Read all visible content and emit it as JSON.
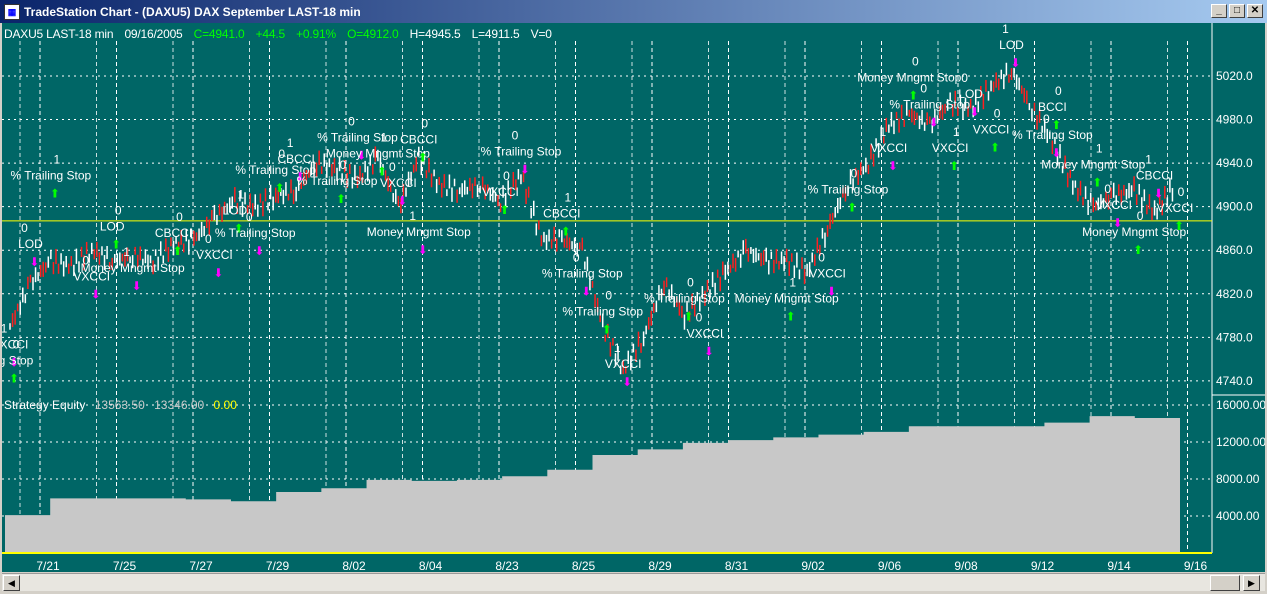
{
  "window": {
    "title": "TradeStation Chart - (DAXU5) DAX September LAST-18 min",
    "minimize": "_",
    "maximize": "□",
    "close": "✕"
  },
  "header": {
    "symbol": "DAXU5 LAST-18 min",
    "date": "09/16/2005",
    "close": "C=4941.0",
    "change": "+44.5",
    "pct": "+0.91%",
    "open": "O=4912.0",
    "high": "H=4945.5",
    "low": "L=4911.5",
    "volume": "V=0"
  },
  "equity_header": {
    "label": "Strategy Equity",
    "v1": "13563.50",
    "v2": "13346.00",
    "v3": "0.00"
  },
  "colors": {
    "bg": "#006666",
    "up": "#ffffff",
    "down": "#ff2020",
    "long": "#00ff00",
    "short": "#ff00ff",
    "ref": "#ffff00",
    "equity": "#c8c8c8"
  },
  "chart_data": [
    {
      "type": "line",
      "name": "price",
      "title": "DAXU5 LAST-18 min",
      "yticks": [
        "5020.0",
        "4980.0",
        "4940.0",
        "4900.0",
        "4860.0",
        "4820.0",
        "4780.0",
        "4740.0"
      ],
      "ylim": [
        4725,
        5060
      ],
      "reference_line": 4887,
      "closes": [
        4790,
        4830,
        4850,
        4845,
        4860,
        4850,
        4855,
        4850,
        4865,
        4870,
        4890,
        4905,
        4900,
        4910,
        4915,
        4940,
        4935,
        4925,
        4945,
        4900,
        4945,
        4920,
        4915,
        4920,
        4905,
        4930,
        4870,
        4870,
        4860,
        4790,
        4750,
        4780,
        4830,
        4800,
        4820,
        4840,
        4860,
        4850,
        4850,
        4840,
        4880,
        4920,
        4940,
        4975,
        4985,
        4975,
        4995,
        4990,
        5010,
        5025,
        4990,
        4960,
        4920,
        4900,
        4910,
        4915,
        4895,
        4920
      ],
      "signals": [
        {
          "i": 0,
          "p": 4770,
          "label": "VXCCI"
        },
        {
          "i": 0,
          "p": 4755,
          "label": "ling Stop"
        },
        {
          "i": 1,
          "p": 4862,
          "label": "LOD"
        },
        {
          "i": 2,
          "p": 4925,
          "label": "% Trailing Stop"
        },
        {
          "i": 4,
          "p": 4832,
          "label": "VXCCI"
        },
        {
          "i": 5,
          "p": 4878,
          "label": "LOD"
        },
        {
          "i": 6,
          "p": 4840,
          "label": "Money Mngmt Stop"
        },
        {
          "i": 8,
          "p": 4872,
          "label": "CBCCI"
        },
        {
          "i": 10,
          "p": 4852,
          "label": "VXCCI"
        },
        {
          "i": 11,
          "p": 4893,
          "label": "LOD"
        },
        {
          "i": 12,
          "p": 4872,
          "label": "% Trailing Stop"
        },
        {
          "i": 13,
          "p": 4930,
          "label": "% Trailing Stop"
        },
        {
          "i": 14,
          "p": 4940,
          "label": "CBCCI"
        },
        {
          "i": 16,
          "p": 4920,
          "label": "% Trailing Stop"
        },
        {
          "i": 17,
          "p": 4960,
          "label": "% Trailing Stop"
        },
        {
          "i": 18,
          "p": 4945,
          "label": "Money Mngmt Stop"
        },
        {
          "i": 19,
          "p": 4918,
          "label": "VXCCI"
        },
        {
          "i": 20,
          "p": 4958,
          "label": "CBCCI"
        },
        {
          "i": 20,
          "p": 4873,
          "label": "Money Mngmt Stop"
        },
        {
          "i": 24,
          "p": 4910,
          "label": "VXCCI"
        },
        {
          "i": 25,
          "p": 4947,
          "label": "% Trailing Stop"
        },
        {
          "i": 27,
          "p": 4890,
          "label": "CBCCI"
        },
        {
          "i": 28,
          "p": 4835,
          "label": "% Trailing Stop"
        },
        {
          "i": 29,
          "p": 4800,
          "label": "% Trailing Stop"
        },
        {
          "i": 30,
          "p": 4752,
          "label": "VXCCI"
        },
        {
          "i": 33,
          "p": 4812,
          "label": "% Trailing Stop"
        },
        {
          "i": 34,
          "p": 4780,
          "label": "VXCCI"
        },
        {
          "i": 38,
          "p": 4812,
          "label": "Money Mngmt Stop"
        },
        {
          "i": 40,
          "p": 4835,
          "label": "VXCCI"
        },
        {
          "i": 41,
          "p": 4912,
          "label": "% Trailing Stop"
        },
        {
          "i": 43,
          "p": 4950,
          "label": "VXCCI"
        },
        {
          "i": 44,
          "p": 5015,
          "label": "Money Mngmt Stop"
        },
        {
          "i": 45,
          "p": 4990,
          "label": "% Trailing Stop"
        },
        {
          "i": 46,
          "p": 4950,
          "label": "VXCCI"
        },
        {
          "i": 47,
          "p": 5000,
          "label": "LOD"
        },
        {
          "i": 48,
          "p": 4967,
          "label": "VXCCI"
        },
        {
          "i": 49,
          "p": 5045,
          "label": "LOD"
        },
        {
          "i": 51,
          "p": 4988,
          "label": "BCCI"
        },
        {
          "i": 51,
          "p": 4962,
          "label": "% Trailing Stop"
        },
        {
          "i": 53,
          "p": 4935,
          "label": "Money Mngmt Stop"
        },
        {
          "i": 54,
          "p": 4898,
          "label": "VXCCI"
        },
        {
          "i": 55,
          "p": 4873,
          "label": "Money Mngmt Stop"
        },
        {
          "i": 56,
          "p": 4925,
          "label": "CBCCI"
        },
        {
          "i": 57,
          "p": 4895,
          "label": "VXCCI"
        }
      ]
    },
    {
      "type": "area",
      "name": "Strategy Equity",
      "yticks": [
        "16000.00",
        "12000.00",
        "8000.00",
        "4000.00"
      ],
      "ylim": [
        0,
        17000
      ],
      "values": [
        4100,
        5900,
        5900,
        5900,
        5800,
        5600,
        6600,
        7000,
        7900,
        7800,
        7900,
        8300,
        9000,
        10600,
        11200,
        11900,
        12200,
        12500,
        12800,
        13100,
        13700,
        13700,
        13700,
        14100,
        14800,
        14600,
        13500
      ]
    },
    {
      "type": "axis",
      "name": "dates",
      "categories": [
        "7/21",
        "7/25",
        "7/27",
        "7/29",
        "8/02",
        "8/04",
        "8/23",
        "8/25",
        "8/29",
        "8/31",
        "9/02",
        "9/06",
        "9/08",
        "9/12",
        "9/14",
        "9/16"
      ]
    }
  ],
  "scrollbar": {
    "left": "◀",
    "right": "▶"
  }
}
